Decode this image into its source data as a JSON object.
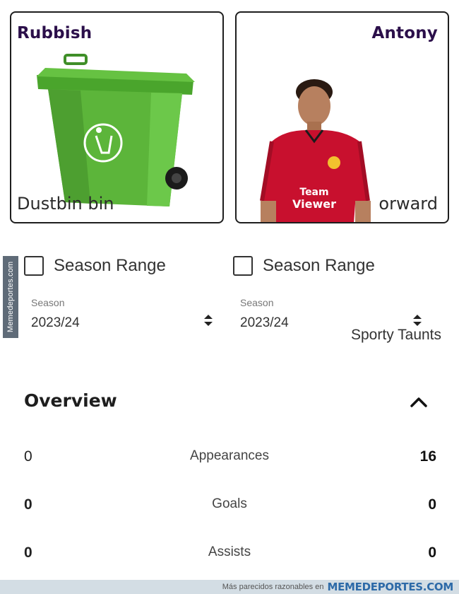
{
  "cards": {
    "left": {
      "title": "Rubbish",
      "caption": "Dustbin bin"
    },
    "right": {
      "title": "Antony",
      "caption": "orward"
    }
  },
  "watermark_side": "Memedeportes.com",
  "filters": {
    "left": {
      "range_label": "Season Range",
      "season_label": "Season",
      "season_value": "2023/24"
    },
    "right": {
      "range_label": "Season Range",
      "season_label": "Season",
      "season_value": "2023/24",
      "extra_label": "Sporty Taunts"
    }
  },
  "overview": {
    "title": "Overview",
    "stats": [
      {
        "left": "0",
        "label": "Appearances",
        "right": "16"
      },
      {
        "left": "0",
        "label": "Goals",
        "right": "0"
      },
      {
        "left": "0",
        "label": "Assists",
        "right": "0"
      }
    ]
  },
  "footer": {
    "small_text": "Más parecidos razonables en",
    "brand": "MEMEDEPORTES.COM"
  },
  "colors": {
    "bin_green": "#5cb53a",
    "kit_red": "#c8102e",
    "title_purple": "#2b0f4a",
    "footer_bg": "#d3dde4",
    "brand_blue": "#2d6aa8"
  },
  "icons": {
    "bin": "green-wheelie-bin-illustration",
    "player": "player-photo",
    "sort": "sort-updown-icon",
    "collapse": "chevron-up-icon"
  }
}
